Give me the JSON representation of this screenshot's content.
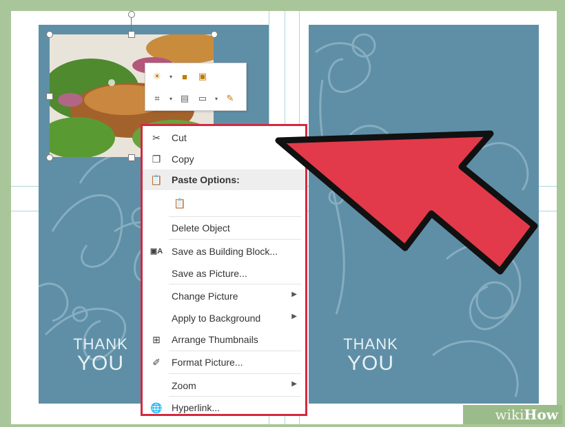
{
  "card": {
    "left_thank": "THANK",
    "left_you": "YOU",
    "right_thank": "THANK",
    "right_you": "YOU"
  },
  "mini_toolbar": {
    "icons": [
      "brightness-icon",
      "bring-forward-icon",
      "send-backward-icon",
      "crop-icon",
      "copy-format-icon",
      "wrap-text-icon",
      "format-painter-icon"
    ]
  },
  "context_menu": {
    "items": [
      {
        "label": "Cut",
        "icon": "scissors-icon"
      },
      {
        "label": "Copy",
        "icon": "copy-icon"
      },
      {
        "label": "Paste Options:",
        "icon": "clipboard-icon"
      },
      {
        "label": "",
        "icon": "paste-icon"
      },
      {
        "label": "Delete Object",
        "icon": ""
      },
      {
        "label": "Save as Building Block...",
        "icon": "building-block-icon"
      },
      {
        "label": "Save as Picture...",
        "icon": ""
      },
      {
        "label": "Change Picture",
        "icon": ""
      },
      {
        "label": "Apply to Background",
        "icon": ""
      },
      {
        "label": "Arrange Thumbnails",
        "icon": "thumbnails-icon"
      },
      {
        "label": "Format Picture...",
        "icon": "format-picture-icon"
      },
      {
        "label": "Zoom",
        "icon": ""
      },
      {
        "label": "Hyperlink...",
        "icon": "hyperlink-icon"
      }
    ]
  },
  "watermark": {
    "wiki": "wiki",
    "how": "How"
  },
  "colors": {
    "menu_border": "#d5283e",
    "arrow_fill": "#e23a4a",
    "panel": "#5f8fa6"
  }
}
